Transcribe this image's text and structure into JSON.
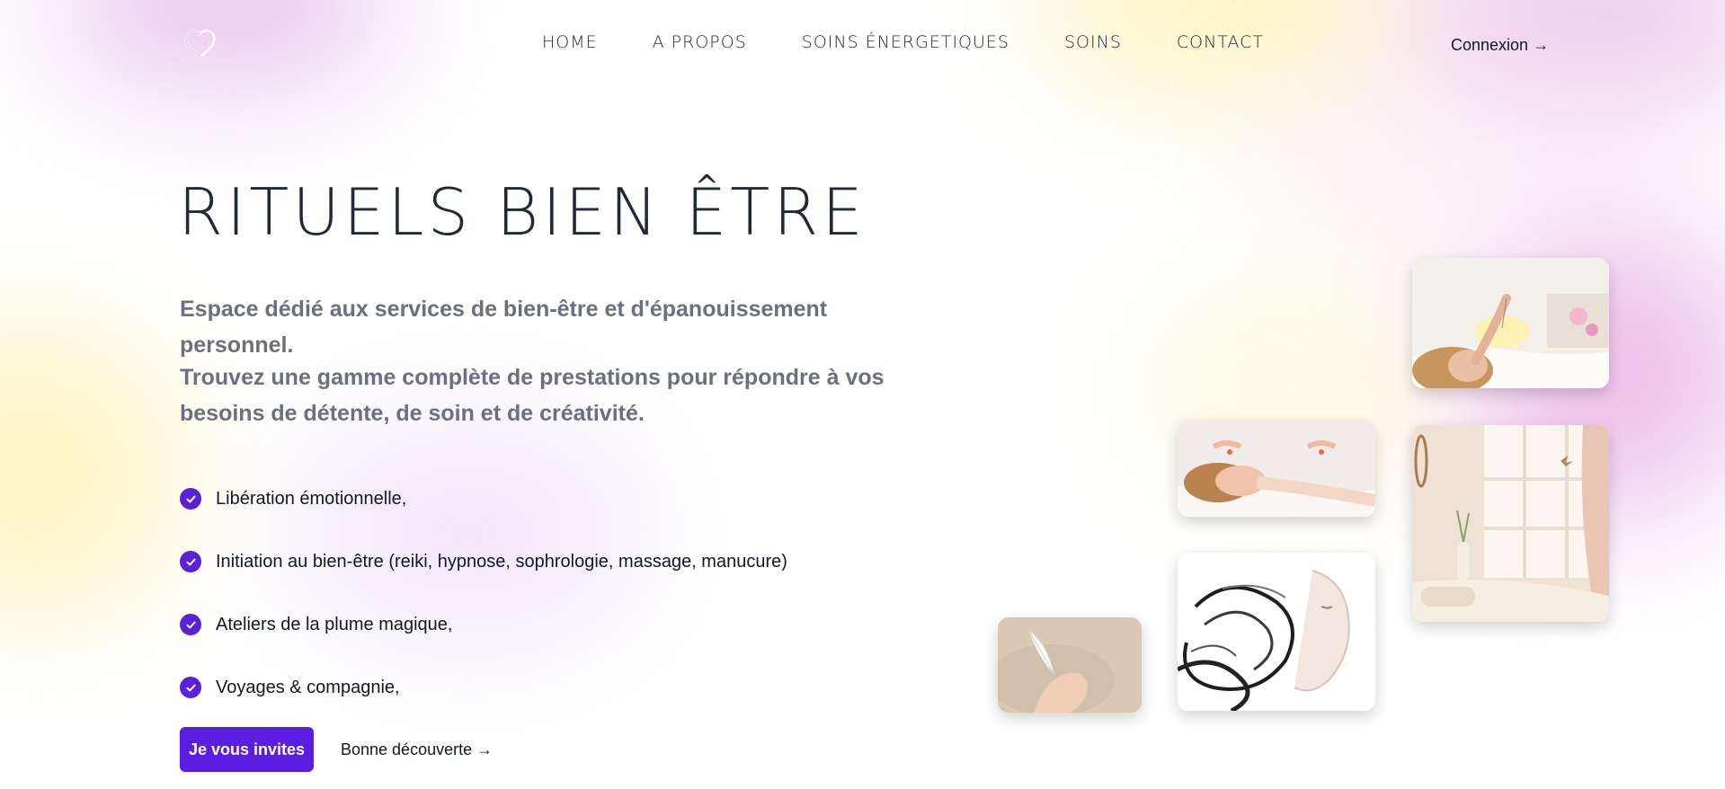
{
  "nav": {
    "logo_icon": "heart-outline-icon",
    "items": [
      {
        "label": "Home"
      },
      {
        "label": "A propos"
      },
      {
        "label": "Soins énergetiques"
      },
      {
        "label": "Soins"
      },
      {
        "label": "Contact"
      }
    ],
    "login_label": "Connexion →"
  },
  "hero": {
    "title": "Rituels bien être",
    "lead": "Espace dédié aux services de bien-être et d'épanouissement personnel.",
    "lead2": "Trouvez une gamme complète de prestations pour répondre à vos besoins de détente, de soin et de créativité.",
    "checklist": [
      {
        "text": "Libération émotionnelle,"
      },
      {
        "text": "Initiation au bien-être (reiki, hypnose, sophrologie, massage, manucure)"
      },
      {
        "text": "Ateliers de la plume magique,"
      },
      {
        "text": "Voyages & compagnie,"
      }
    ],
    "check_icon": "check-circle-icon",
    "cta_label": "Je vous invites",
    "secondary_label": "Bonne découverte →"
  },
  "theme": {
    "accent": "#5b1ee0",
    "text": "#111827",
    "muted": "#6b6f80"
  }
}
